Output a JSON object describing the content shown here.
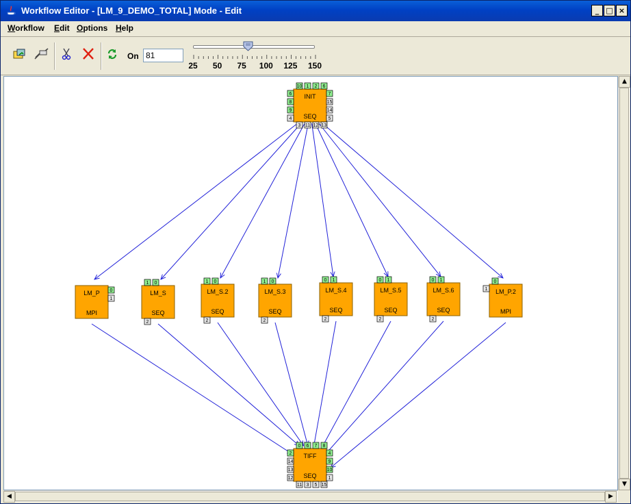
{
  "window": {
    "title": "Workflow Editor - [LM_9_DEMO_TOTAL]  Mode - Edit",
    "controls": [
      "_",
      "□",
      "×"
    ]
  },
  "menu": [
    "Workflow",
    "Edit",
    "Options",
    "Help"
  ],
  "toolbar": {
    "icons": [
      "open-workflow-icon",
      "link-icon",
      "cut-icon",
      "delete-icon",
      "refresh-icon"
    ],
    "on_label": "On",
    "zoom_value": "81",
    "slider_value": 81,
    "slider_min": 25,
    "slider_max": 150,
    "slider_ticks": [
      "25",
      "50",
      "75",
      "100",
      "125",
      "150"
    ]
  },
  "graph": {
    "nodes": [
      {
        "id": "INIT",
        "name": "INIT",
        "type": "SEQ",
        "ports": {
          "top": [
            [
              "10",
              "g"
            ],
            [
              "1",
              "g"
            ],
            [
              "2",
              "g"
            ],
            [
              "6",
              "g"
            ]
          ],
          "right": [
            [
              "7",
              "g"
            ],
            [
              "15",
              "w"
            ],
            [
              "14",
              "w"
            ],
            [
              "5",
              "w"
            ]
          ],
          "left": [
            [
              "6",
              "g"
            ],
            [
              "8",
              "g"
            ],
            [
              "9",
              "g"
            ],
            [
              "4",
              "w"
            ]
          ],
          "bottom": [
            [
              "3",
              "w"
            ],
            [
              "11",
              "w"
            ],
            [
              "12",
              "w"
            ],
            [
              "13",
              "w"
            ]
          ]
        }
      },
      {
        "id": "LM_P",
        "name": "LM_P",
        "type": "MPI",
        "ports": {
          "top": [],
          "right": [
            [
              "0",
              "g"
            ],
            [
              "1",
              "w"
            ]
          ],
          "left": [],
          "bottom": []
        }
      },
      {
        "id": "LM_S",
        "name": "LM_S",
        "type": "SEQ",
        "ports": {
          "top": [
            [
              "1",
              "g"
            ],
            [
              "0",
              "g"
            ]
          ],
          "right": [],
          "left": [],
          "bottom": [
            [
              "2",
              "w"
            ]
          ]
        }
      },
      {
        "id": "LM_S.2",
        "name": "LM_S.2",
        "type": "SEQ",
        "ports": {
          "top": [
            [
              "1",
              "g"
            ],
            [
              "0",
              "g"
            ]
          ],
          "right": [],
          "left": [],
          "bottom": [
            [
              "2",
              "w"
            ]
          ]
        }
      },
      {
        "id": "LM_S.3",
        "name": "LM_S.3",
        "type": "SEQ",
        "ports": {
          "top": [
            [
              "1",
              "g"
            ],
            [
              "0",
              "g"
            ]
          ],
          "right": [],
          "left": [],
          "bottom": [
            [
              "2",
              "w"
            ]
          ]
        }
      },
      {
        "id": "LM_S.4",
        "name": "LM_S.4",
        "type": "SEQ",
        "ports": {
          "top": [
            [
              "0",
              "g"
            ],
            [
              "1",
              "g"
            ]
          ],
          "right": [],
          "left": [],
          "bottom": [
            [
              "2",
              "w"
            ]
          ]
        }
      },
      {
        "id": "LM_S.5",
        "name": "LM_S.5",
        "type": "SEQ",
        "ports": {
          "top": [
            [
              "0",
              "g"
            ],
            [
              "1",
              "g"
            ]
          ],
          "right": [],
          "left": [],
          "bottom": [
            [
              "2",
              "w"
            ]
          ]
        }
      },
      {
        "id": "LM_S.6",
        "name": "LM_S.6",
        "type": "SEQ",
        "ports": {
          "top": [
            [
              "0",
              "g"
            ],
            [
              "1",
              "g"
            ]
          ],
          "right": [],
          "left": [],
          "bottom": [
            [
              "2",
              "w"
            ]
          ]
        }
      },
      {
        "id": "LM_P.2",
        "name": "LM_P.2",
        "type": "MPI",
        "ports": {
          "top": [
            [
              "0",
              "g"
            ]
          ],
          "right": [],
          "left": [
            [
              "1",
              "w"
            ]
          ],
          "bottom": []
        }
      },
      {
        "id": "TIFF",
        "name": "TIFF",
        "type": "SEQ",
        "ports": {
          "top": [
            [
              "0",
              "g"
            ],
            [
              "6",
              "g"
            ],
            [
              "7",
              "g"
            ],
            [
              "8",
              "g"
            ]
          ],
          "right": [
            [
              "4",
              "g"
            ],
            [
              "9",
              "g"
            ],
            [
              "10",
              "g"
            ],
            [
              "1",
              "w"
            ]
          ],
          "left": [
            [
              "2",
              "g"
            ],
            [
              "14",
              "w"
            ],
            [
              "13",
              "w"
            ],
            [
              "12",
              "w"
            ]
          ],
          "bottom": [
            [
              "11",
              "w"
            ],
            [
              "3",
              "w"
            ],
            [
              "5",
              "w"
            ],
            [
              "15",
              "w"
            ]
          ]
        }
      }
    ],
    "edges": [
      [
        "INIT",
        "LM_P"
      ],
      [
        "INIT",
        "LM_S"
      ],
      [
        "INIT",
        "LM_S.2"
      ],
      [
        "INIT",
        "LM_S.3"
      ],
      [
        "INIT",
        "LM_S.4"
      ],
      [
        "INIT",
        "LM_S.5"
      ],
      [
        "INIT",
        "LM_S.6"
      ],
      [
        "INIT",
        "LM_P.2"
      ],
      [
        "LM_P",
        "TIFF"
      ],
      [
        "LM_S",
        "TIFF"
      ],
      [
        "LM_S.2",
        "TIFF"
      ],
      [
        "LM_S.3",
        "TIFF"
      ],
      [
        "LM_S.4",
        "TIFF"
      ],
      [
        "LM_S.5",
        "TIFF"
      ],
      [
        "LM_S.6",
        "TIFF"
      ],
      [
        "LM_P.2",
        "TIFF"
      ]
    ]
  },
  "scrollbars": {
    "up": "▲",
    "down": "▼",
    "left": "◀",
    "right": "▶"
  }
}
